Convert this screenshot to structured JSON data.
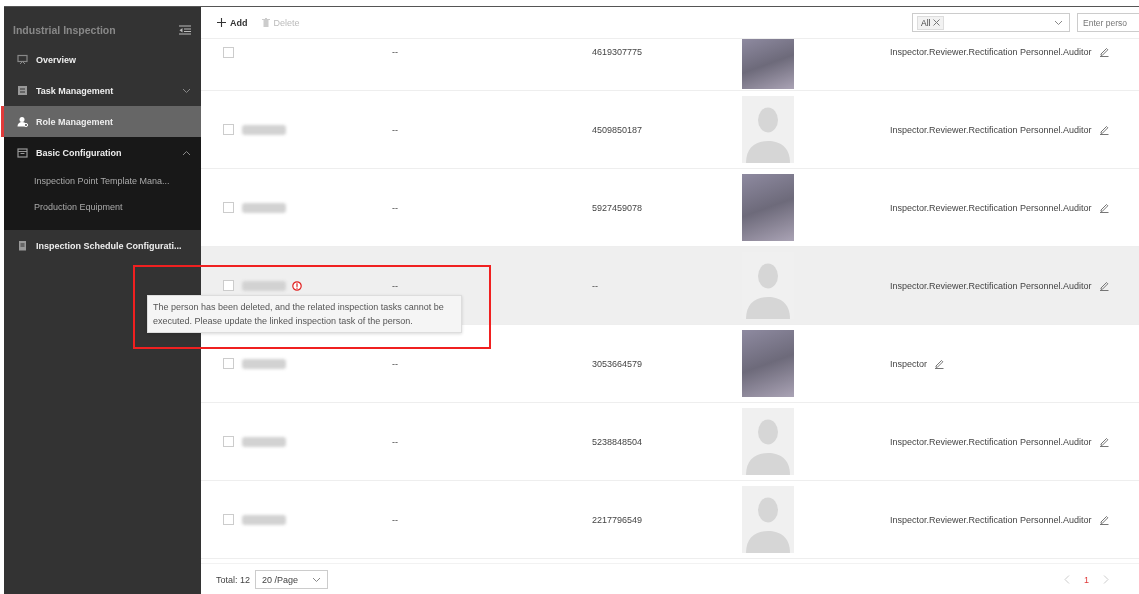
{
  "sidebar": {
    "title": "Industrial Inspection",
    "items": [
      {
        "label": "Overview",
        "selected": false
      },
      {
        "label": "Task Management",
        "selected": false,
        "expanded": false
      },
      {
        "label": "Role Management",
        "selected": true
      },
      {
        "label": "Basic Configuration",
        "selected": false,
        "expanded": true,
        "children": [
          {
            "label": "Inspection Point Template Mana...",
            "selected": false
          },
          {
            "label": "Production Equipment",
            "selected": false
          }
        ]
      },
      {
        "label": "Inspection Schedule Configurati...",
        "selected": false
      }
    ]
  },
  "toolbar": {
    "add": "Add",
    "delete": {
      "label": "Delete",
      "disabled": true
    },
    "filter": {
      "tag": "All"
    },
    "search": {
      "placeholder": "Enter perso"
    }
  },
  "table": {
    "rows": [
      {
        "checked": false,
        "name_blurred": false,
        "warning": false,
        "highlighted": false,
        "column_2": "--",
        "column_3": "4619307775",
        "kind": "photo",
        "roles": "Inspector.Reviewer.Rectification Personnel.Auditor"
      },
      {
        "checked": false,
        "name_blurred": true,
        "warning": false,
        "highlighted": false,
        "column_2": "--",
        "column_3": "4509850187",
        "kind": "silhouette",
        "roles": "Inspector.Reviewer.Rectification Personnel.Auditor"
      },
      {
        "checked": false,
        "name_blurred": true,
        "warning": false,
        "highlighted": false,
        "column_2": "--",
        "column_3": "5927459078",
        "kind": "photo",
        "roles": "Inspector.Reviewer.Rectification Personnel.Auditor"
      },
      {
        "checked": false,
        "name_blurred": true,
        "warning": true,
        "highlighted": true,
        "column_2": "--",
        "column_3": "--",
        "kind": "silhouette",
        "roles": "Inspector.Reviewer.Rectification Personnel.Auditor"
      },
      {
        "checked": false,
        "name_blurred": true,
        "warning": false,
        "highlighted": false,
        "column_2": "--",
        "column_3": "3053664579",
        "kind": "photo",
        "roles": "Inspector"
      },
      {
        "checked": false,
        "name_blurred": true,
        "warning": false,
        "highlighted": false,
        "column_2": "--",
        "column_3": "5238848504",
        "kind": "silhouette",
        "roles": "Inspector.Reviewer.Rectification Personnel.Auditor"
      },
      {
        "checked": false,
        "name_blurred": true,
        "warning": false,
        "highlighted": false,
        "column_2": "--",
        "column_3": "2217796549",
        "kind": "silhouette",
        "roles": "Inspector.Reviewer.Rectification Personnel.Auditor"
      }
    ]
  },
  "tooltip": "The person has been deleted, and the related inspection tasks cannot be executed. Please update the linked inspection task of the person.",
  "footer": {
    "total": "Total: 12",
    "page_size": "20 /Page",
    "pages": [
      {
        "label": "1",
        "selected": true
      }
    ]
  }
}
